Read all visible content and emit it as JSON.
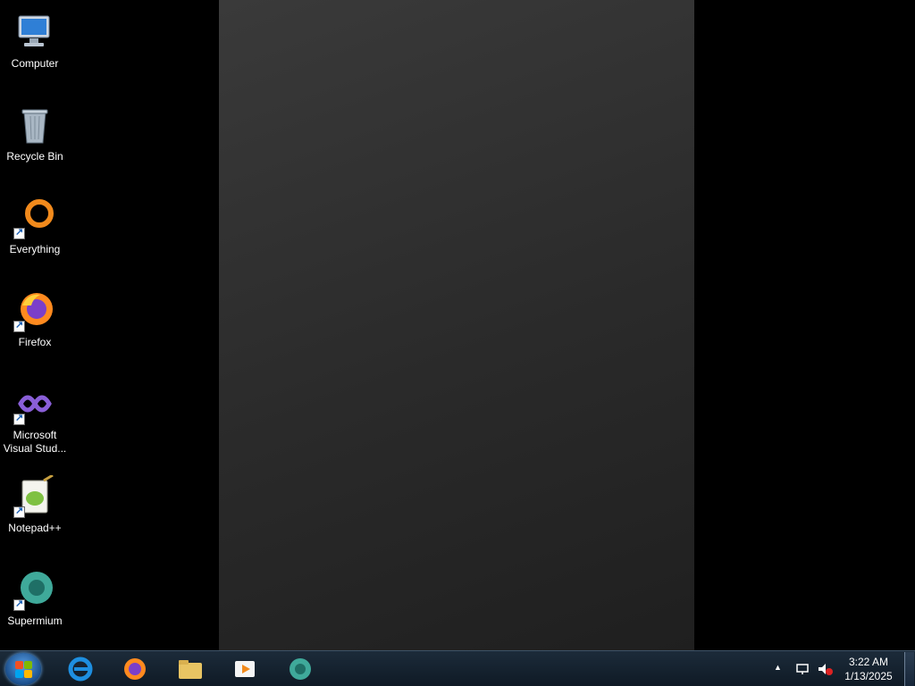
{
  "desktop": {
    "icons": [
      {
        "label": "Computer",
        "icon": "computer-icon"
      },
      {
        "label": "Recycle Bin",
        "icon": "recycle-bin-icon"
      },
      {
        "label": "Everything",
        "icon": "everything-icon"
      },
      {
        "label": "Firefox",
        "icon": "firefox-icon"
      },
      {
        "label": "Microsoft Visual Stud...",
        "icon": "visual-studio-icon"
      },
      {
        "label": "Notepad++",
        "icon": "notepadpp-icon"
      },
      {
        "label": "Supermium",
        "icon": "supermium-icon"
      }
    ]
  },
  "taskbar": {
    "pinned": [
      "internet-explorer-icon",
      "firefox-icon",
      "file-explorer-icon",
      "media-player-icon",
      "supermium-icon"
    ],
    "tray": {
      "time": "3:22 AM",
      "date": "1/13/2025"
    }
  },
  "colors": {
    "taskbar": "#0f1a25",
    "desktop": "#000000",
    "accent": "#1b4f8c"
  }
}
